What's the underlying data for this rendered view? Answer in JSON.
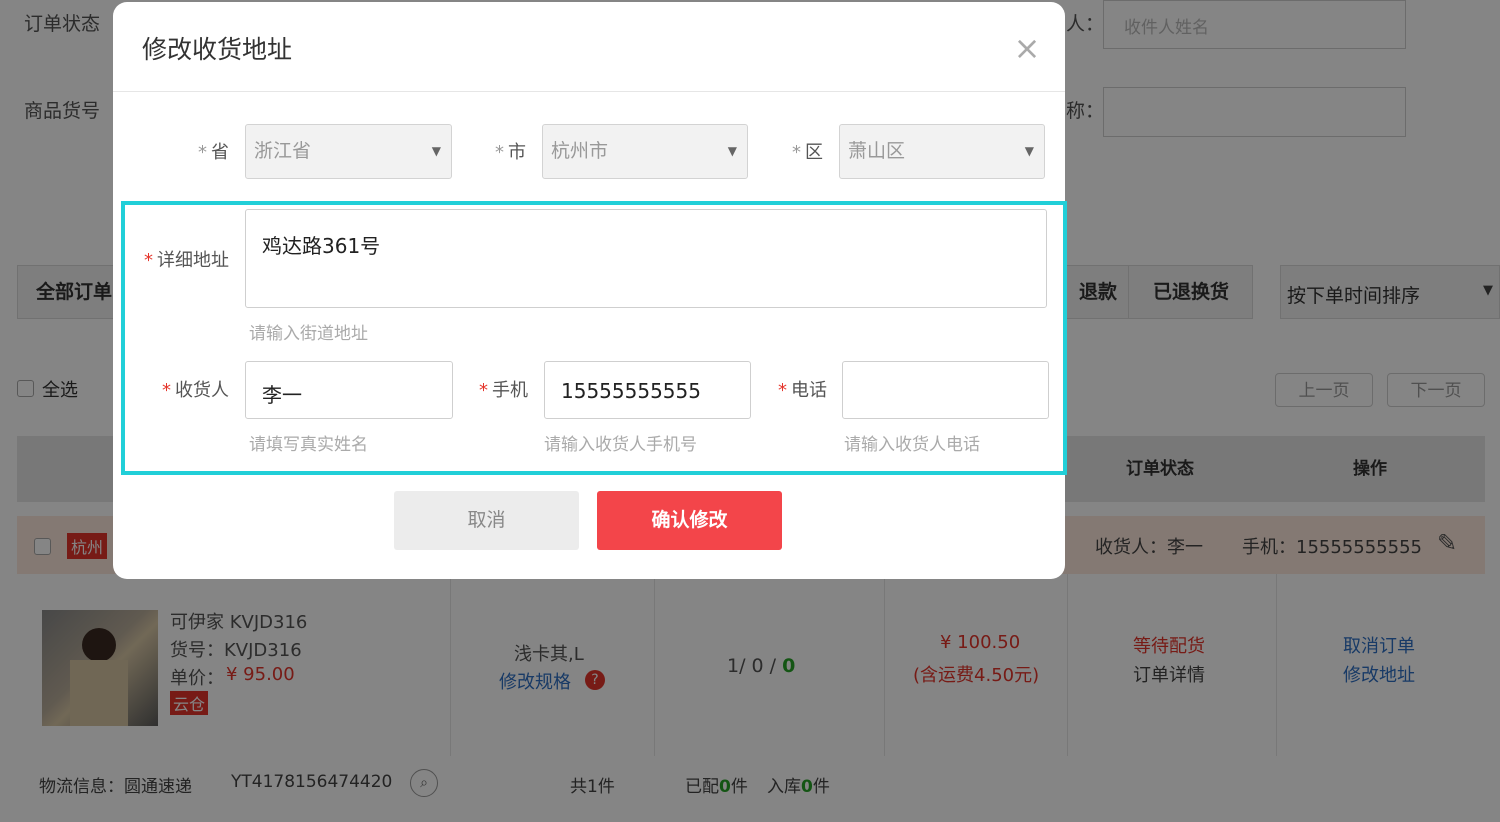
{
  "filters": {
    "order_status_label": "订单状态",
    "goods_no_label": "商品货号",
    "receiver_label_tail": "人：",
    "receiver_placeholder": "收件人姓名",
    "name_label_tail": "称："
  },
  "tabs": {
    "all_orders": "全部订单",
    "refund": "退款",
    "returned": "已退换货"
  },
  "sort": {
    "selected": "按下单时间排序"
  },
  "list_controls": {
    "select_all": "全选",
    "prev": "上一页",
    "next": "下一页"
  },
  "table_head": {
    "status": "订单状态",
    "action": "操作"
  },
  "order": {
    "warehouse_tag": "杭州",
    "receiver": "收货人：李一",
    "phone": "手机：15555555555",
    "product_name": "可伊家 KVJD316",
    "sku": "货号：KVJD316",
    "price_label": "单价：",
    "price": "¥ 95.00",
    "cloud_tag": "云仓",
    "spec": "浅卡其,L",
    "edit_spec": "修改规格",
    "qty_a": "1/ 0 / ",
    "qty_b": "0",
    "amount": "¥ 100.50",
    "shipping_note": "(含运费4.50元)",
    "status": "等待配货",
    "detail_link": "订单详情",
    "cancel_link": "取消订单",
    "edit_address_link": "修改地址",
    "logistics": "物流信息：圆通速递",
    "tracking": "YT4178156474420",
    "total": "共1件",
    "assigned_a": "已配",
    "assigned_b": "0",
    "assigned_c": "件",
    "stock_a": "入库",
    "stock_b": "0",
    "stock_c": "件"
  },
  "dialog": {
    "title": "修改收货地址",
    "province_label": "省",
    "province_value": "浙江省",
    "city_label": "市",
    "city_value": "杭州市",
    "district_label": "区",
    "district_value": "萧山区",
    "detail_label": "详细地址",
    "detail_value": "鸡达路361号",
    "detail_hint": "请输入街道地址",
    "receiver_label": "收货人",
    "receiver_value": "李一",
    "receiver_hint": "请填写真实姓名",
    "mobile_label": "手机",
    "mobile_value": "15555555555",
    "mobile_hint": "请输入收货人手机号",
    "tel_label": "电话",
    "tel_value": "",
    "tel_hint": "请输入收货人电话",
    "cancel": "取消",
    "confirm": "确认修改"
  },
  "colors": {
    "accent_red": "#f3454a",
    "highlight": "#21cfd8",
    "link_blue": "#2f6fc4"
  }
}
